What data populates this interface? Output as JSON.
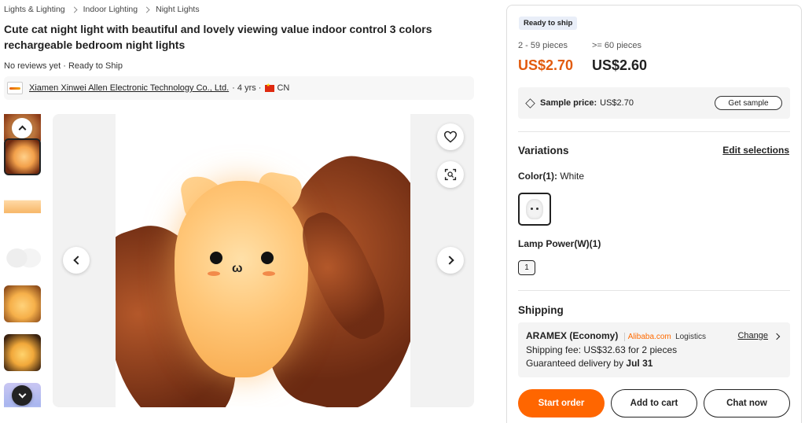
{
  "breadcrumb": [
    "Lights & Lighting",
    "Indoor Lighting",
    "Night Lights"
  ],
  "product": {
    "title": "Cute cat night light with beautiful and lovely viewing value indoor control 3 colors rechargeable bedroom night lights",
    "reviews": "No reviews yet",
    "separator": "·",
    "ship_status": "Ready to Ship"
  },
  "supplier": {
    "name": "Xiamen Xinwei Allen Electronic Technology Co., Ltd.",
    "years": "· 4 yrs ·",
    "country": "CN"
  },
  "gallery": {
    "thumbnail_count": 7,
    "active_thumbnail": 1,
    "icons": [
      "chevron-up-icon",
      "chevron-down-icon",
      "heart-icon",
      "scan-search-icon",
      "chevron-left-icon",
      "chevron-right-icon"
    ]
  },
  "panel": {
    "badge": "Ready to ship",
    "tiers": [
      {
        "range": "2 - 59 pieces",
        "price": "US$2.70",
        "color": "#e25b0e"
      },
      {
        "range": ">= 60 pieces",
        "price": "US$2.60",
        "color": "#222222"
      }
    ],
    "sample": {
      "label": "Sample price:",
      "price": "US$2.70",
      "button": "Get sample"
    },
    "variations": {
      "title": "Variations",
      "edit": "Edit selections",
      "color_label": "Color(1):",
      "color_value": "White",
      "power_label": "Lamp Power(W)(1)",
      "power_value": "1"
    },
    "shipping": {
      "title": "Shipping",
      "method": "ARAMEX (Economy)",
      "logo": "Alibaba.com",
      "logo_sub": "Logistics",
      "change": "Change",
      "fee": "Shipping fee: US$32.63 for 2 pieces",
      "delivery_prefix": "Guaranteed delivery by",
      "delivery_date": "Jul 31"
    },
    "actions": {
      "start": "Start order",
      "cart": "Add to cart",
      "chat": "Chat now"
    }
  },
  "colors": {
    "accent": "#ff6600",
    "price": "#e25b0e"
  }
}
